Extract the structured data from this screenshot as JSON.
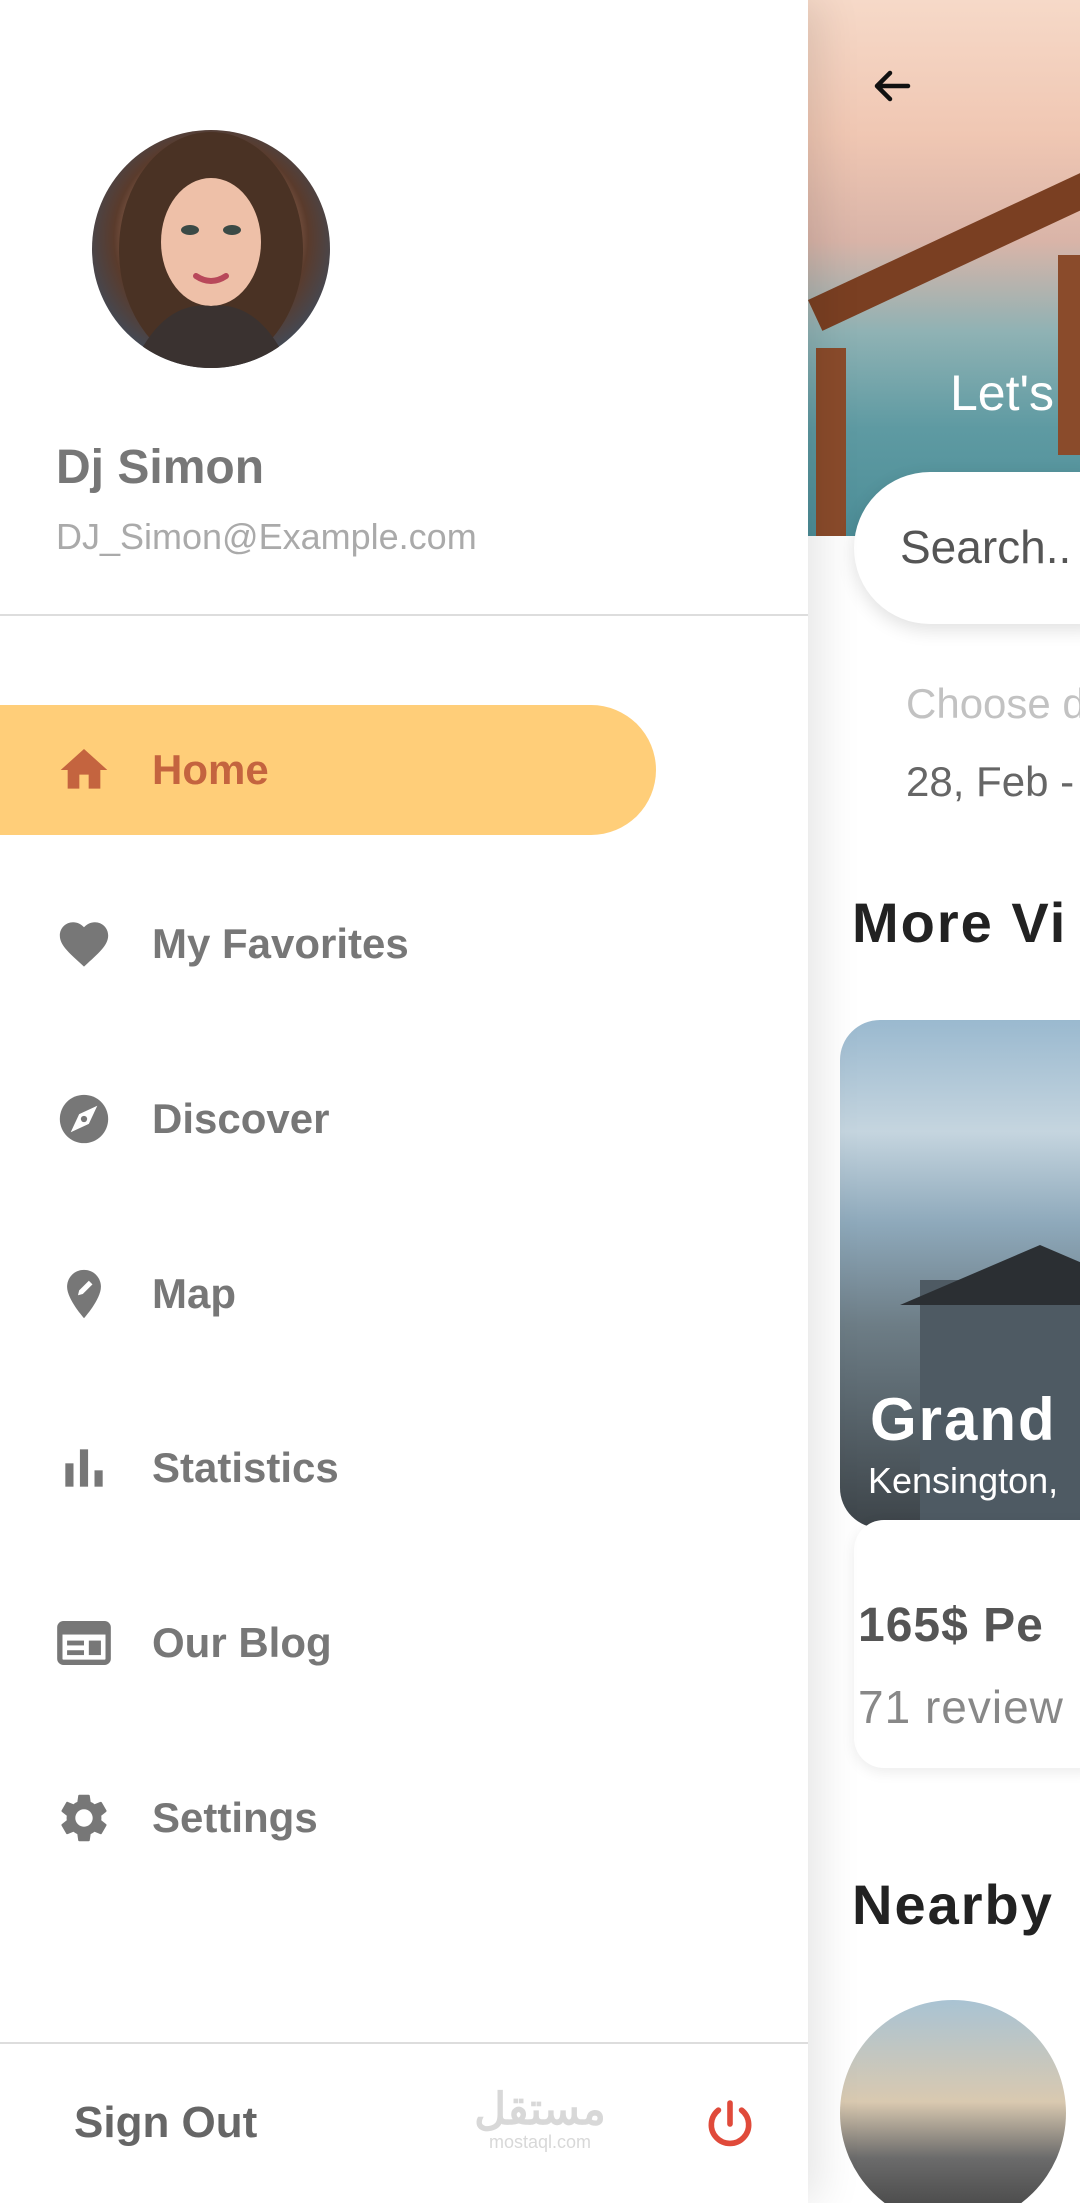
{
  "drawer": {
    "user": {
      "name": "Dj Simon",
      "email": "DJ_Simon@Example.com"
    },
    "nav": [
      {
        "label": "Home",
        "icon": "home-icon",
        "active": true
      },
      {
        "label": "My Favorites",
        "icon": "heart-icon",
        "active": false
      },
      {
        "label": "Discover",
        "icon": "compass-icon",
        "active": false
      },
      {
        "label": "Map",
        "icon": "map-pin-icon",
        "active": false
      },
      {
        "label": "Statistics",
        "icon": "bar-chart-icon",
        "active": false
      },
      {
        "label": "Our Blog",
        "icon": "blog-icon",
        "active": false
      },
      {
        "label": "Settings",
        "icon": "gear-icon",
        "active": false
      }
    ],
    "sign_out_label": "Sign Out",
    "watermark": {
      "arabic": "مستقل",
      "latin": "mostaql.com"
    }
  },
  "main": {
    "hero_text": "Let's",
    "search_placeholder": "Search..",
    "choose_label": "Choose d",
    "date_value": "28, Feb -",
    "more_title": "More Vi",
    "card": {
      "title": "Grand",
      "location": "Kensington,",
      "price": "165$  Pe",
      "reviews": "71 review"
    },
    "nearby_title": "Nearby"
  },
  "colors": {
    "active_bg": "#ffce79",
    "active_text": "#c4643f",
    "nav_text": "#777777",
    "power": "#e04a3a"
  }
}
